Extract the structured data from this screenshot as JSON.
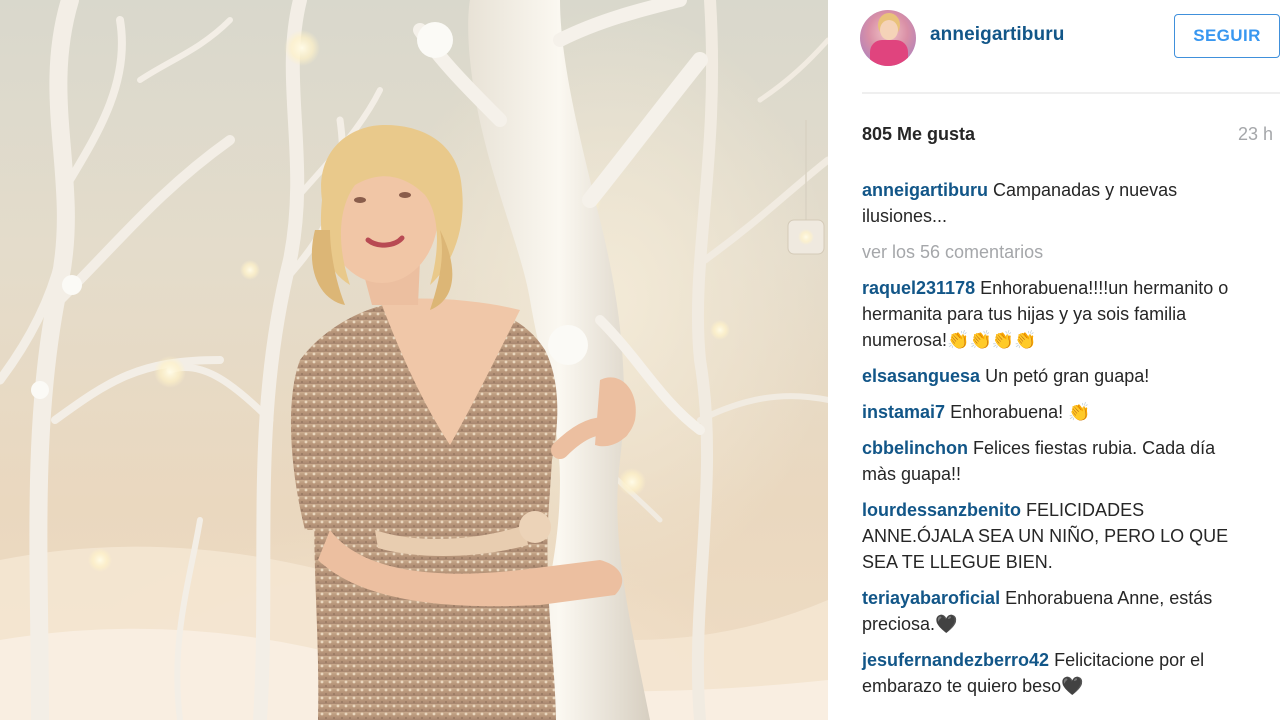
{
  "post": {
    "author": "anneigartiburu",
    "follow_label": "SEGUIR",
    "likes": "805 Me gusta",
    "timestamp": "23 h",
    "caption": "Campanadas y nuevas ilusiones...",
    "view_comments": "ver los 56 comentarios"
  },
  "comments": [
    {
      "user": "raquel231178",
      "text": "Enhorabuena!!!!un hermanito o hermanita para tus hijas y ya sois familia numerosa!👏👏👏👏"
    },
    {
      "user": "elsasanguesa",
      "text": "Un petó gran guapa!"
    },
    {
      "user": "instamai7",
      "text": "Enhorabuena! 👏"
    },
    {
      "user": "cbbelinchon",
      "text": "Felices fiestas rubia. Cada día màs guapa!!"
    },
    {
      "user": "lourdessanzbenito",
      "text": "FELICIDADES ANNE.ÓJALA SEA UN NIÑO, PERO LO QUE SEA TE LLEGUE BIEN."
    },
    {
      "user": "teriayabaroficial",
      "text": "Enhorabuena Anne, estás preciosa.🖤"
    },
    {
      "user": "jesufernandezberro42",
      "text": "Felicitacione por el embarazo te quiero beso🖤"
    }
  ],
  "icons": {
    "avatar": "profile-photo",
    "photo": "post-photo"
  },
  "colors": {
    "link": "#125688",
    "button": "#3897f0",
    "muted": "#a5a7aa"
  }
}
